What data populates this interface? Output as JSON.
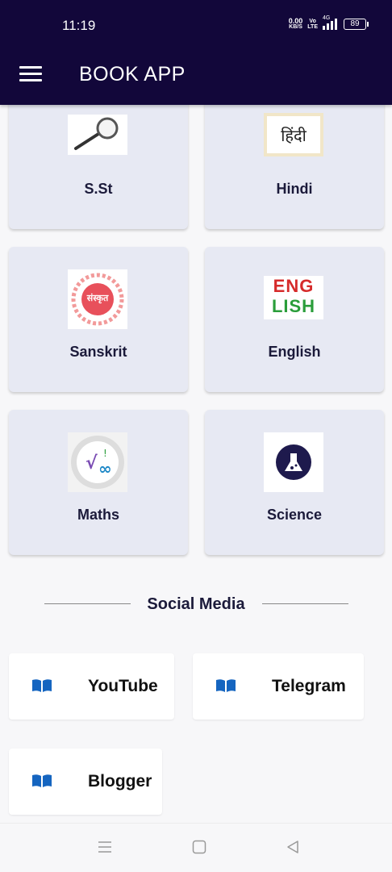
{
  "status": {
    "time": "11:19",
    "speed": "0.00",
    "speed_unit": "KB/S",
    "net_top": "Vo",
    "net_bottom": "LTE",
    "signal": "4G",
    "battery": "89"
  },
  "appbar": {
    "title": "BOOK APP",
    "menu_icon": "hamburger-menu-icon"
  },
  "subjects": [
    {
      "label": "S.St",
      "icon": "magnifier-icon"
    },
    {
      "label": "Hindi",
      "icon": "hindi-script-icon",
      "thumb_text": "हिंदी"
    },
    {
      "label": "Sanskrit",
      "icon": "sanskrit-emblem-icon",
      "thumb_text": "संस्कृत"
    },
    {
      "label": "English",
      "icon": "english-letters-icon",
      "thumb_line1": "ENG",
      "thumb_line2": "LISH"
    },
    {
      "label": "Maths",
      "icon": "maths-symbols-icon"
    },
    {
      "label": "Science",
      "icon": "science-flask-icon"
    }
  ],
  "social": {
    "title": "Social Media",
    "items": [
      {
        "label": "YouTube",
        "icon": "book-icon"
      },
      {
        "label": "Telegram",
        "icon": "book-icon"
      },
      {
        "label": "Blogger",
        "icon": "book-icon"
      }
    ]
  },
  "colors": {
    "appbar": "#12073a",
    "card": "#e7e9f3",
    "book_icon": "#1565c0",
    "text": "#1b1a3a"
  }
}
